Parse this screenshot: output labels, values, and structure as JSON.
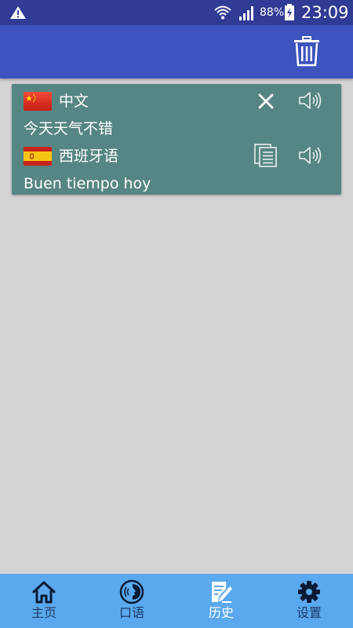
{
  "status_bar": {
    "battery_percent": "88%",
    "time": "23:09",
    "icons": [
      "warning-icon",
      "wifi-icon",
      "signal-icon",
      "battery-charging-icon"
    ]
  },
  "app_bar": {
    "action_icon": "trash-icon"
  },
  "history": [
    {
      "source_lang": "中文",
      "source_flag": "china-flag",
      "source_text": "今天天气不错",
      "target_lang": "西班牙语",
      "target_flag": "spain-flag",
      "target_text": "Buen tiempo hoy"
    }
  ],
  "bottom_nav": {
    "items": [
      {
        "label": "主页",
        "icon": "home-icon",
        "active": false
      },
      {
        "label": "口语",
        "icon": "speak-icon",
        "active": false
      },
      {
        "label": "历史",
        "icon": "history-icon",
        "active": true
      },
      {
        "label": "设置",
        "icon": "settings-icon",
        "active": false
      }
    ]
  },
  "colors": {
    "status_bar": "#2f3b94",
    "app_bar": "#3d53bd",
    "background": "#d5d3d4",
    "card": "#568683",
    "bottom_nav": "#5aa9ee",
    "nav_label": "#1f3a66",
    "nav_label_active": "#ffffff"
  }
}
